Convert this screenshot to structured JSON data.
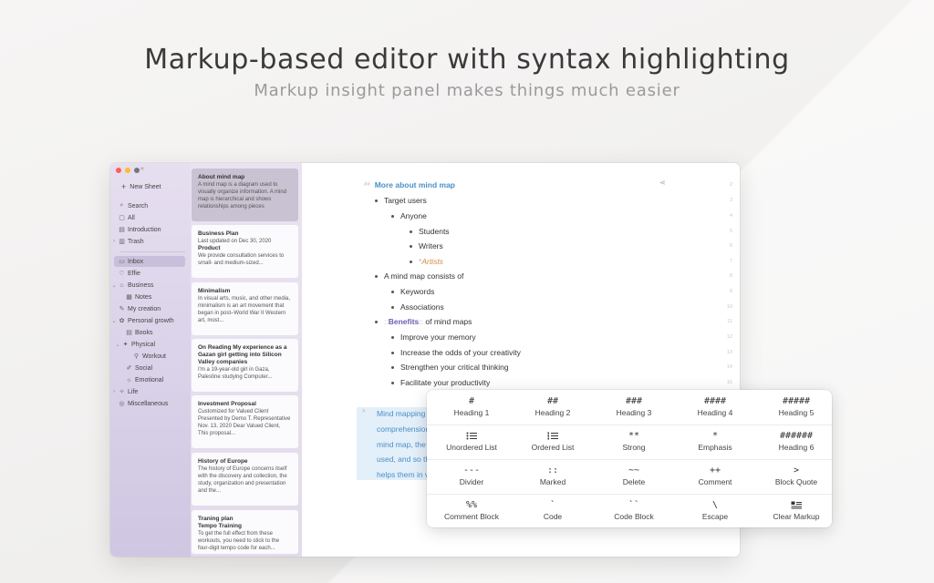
{
  "hero": {
    "title": "Markup-based editor with syntax highlighting",
    "subtitle": "Markup insight panel makes things much easier"
  },
  "sidebar": {
    "new_sheet": "New Sheet",
    "items": [
      {
        "label": "Search",
        "icon": "search-icon"
      },
      {
        "label": "All",
        "icon": "doc-icon"
      },
      {
        "label": "Introduction",
        "icon": "book-icon"
      },
      {
        "label": "Trash",
        "icon": "trash-icon"
      },
      {
        "label": "Inbox",
        "icon": "inbox-icon"
      },
      {
        "label": "Effie",
        "icon": "heart-icon"
      },
      {
        "label": "Business",
        "icon": "folder-icon"
      },
      {
        "label": "Notes",
        "icon": "notes-icon"
      },
      {
        "label": "My creation",
        "icon": "creation-icon"
      },
      {
        "label": "Personal growth",
        "icon": "growth-icon"
      },
      {
        "label": "Books",
        "icon": "books-icon"
      },
      {
        "label": "Physical",
        "icon": "physical-icon"
      },
      {
        "label": "Workout",
        "icon": "workout-icon"
      },
      {
        "label": "Social",
        "icon": "social-icon"
      },
      {
        "label": "Emotional",
        "icon": "emotional-icon"
      },
      {
        "label": "Life",
        "icon": "life-icon"
      },
      {
        "label": "Miscellaneous",
        "icon": "misc-icon"
      }
    ]
  },
  "notes": [
    {
      "title": "About mind map",
      "body": "A mind map is a diagram used to visually organize information. A mind map is hierarchical and shows relationships among pieces"
    },
    {
      "title": "Business Plan",
      "body": "Last updated on Dec 30, 2020",
      "title2": "Product",
      "body2": "We provide consultation services to small- and medium-sized..."
    },
    {
      "title": "Minimalism",
      "body": "In visual arts, music, and other media, minimalism is an art movement that began in post–World War II Western art, most..."
    },
    {
      "title": "On Reading My experience as a Gazan girl getting into Silicon Valley companies",
      "body": "I'm a 19-year-old girl in Gaza, Palestine studying Computer..."
    },
    {
      "title": "Investment Proposal",
      "body": "Customized for Valued Client Presented by Demo T. Representative Nov. 13, 2020 Dear Valued Client, This proposal..."
    },
    {
      "title": "History of Europe",
      "body": "The history of Europe concerns itself with the discovery and collection, the study, organization and presentation and the..."
    },
    {
      "title": "Traning plan",
      "title2": "Tempo Training",
      "body": "To get the full effect from these workouts, you need to stick to the four-digit tempo code for each..."
    }
  ],
  "editor": {
    "heading_prefix": "##",
    "heading": "More about mind map",
    "lines": [
      "Target users",
      "Anyone",
      "Students",
      "Writers",
      "Artists",
      "A mind map consists of",
      "Keywords",
      "Associations",
      "Benefits",
      "of mind maps",
      "Improve your memory",
      "Increase the odds of your creativity",
      "Strengthen your critical thinking",
      "Facilitate your productivity"
    ],
    "line_numbers": [
      "3",
      "4",
      "5",
      "6",
      "7",
      "8",
      "9",
      "10",
      "11",
      "12",
      "13",
      "14",
      "15",
      "16"
    ],
    "blue_lines": [
      "Mind mapping",
      "comprehension",
      "mind map, the",
      "used, and so th",
      "helps them in v"
    ]
  },
  "panel": {
    "items": [
      {
        "sym": "#",
        "label": "Heading 1"
      },
      {
        "sym": "##",
        "label": "Heading 2"
      },
      {
        "sym": "###",
        "label": "Heading 3"
      },
      {
        "sym": "####",
        "label": "Heading 4"
      },
      {
        "sym": "#####",
        "label": "Heading 5"
      },
      {
        "sym": "",
        "label": "Unordered List"
      },
      {
        "sym": "",
        "label": "Ordered List"
      },
      {
        "sym": "**",
        "label": "Strong"
      },
      {
        "sym": "*",
        "label": "Emphasis"
      },
      {
        "sym": "######",
        "label": "Heading 6"
      },
      {
        "sym": "---",
        "label": "Divider"
      },
      {
        "sym": "::",
        "label": "Marked"
      },
      {
        "sym": "~~",
        "label": "Delete"
      },
      {
        "sym": "++",
        "label": "Comment"
      },
      {
        "sym": ">",
        "label": "Block Quote"
      },
      {
        "sym": "%%",
        "label": "Comment Block"
      },
      {
        "sym": "`",
        "label": "Code"
      },
      {
        "sym": "``",
        "label": "Code Block"
      },
      {
        "sym": "\\",
        "label": "Escape"
      },
      {
        "sym": "",
        "label": "Clear Markup"
      }
    ]
  },
  "colors": {
    "heading": "#4a90c8",
    "artists": "#d08a46",
    "benefits": "#6a5fb0",
    "sidebar": "#dcd5ea"
  }
}
